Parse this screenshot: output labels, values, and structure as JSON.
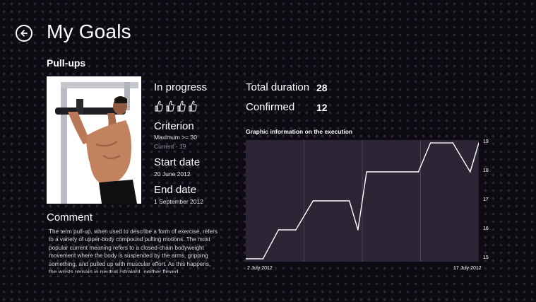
{
  "header": {
    "back_icon": "arrow-left-icon",
    "title": "My Goals"
  },
  "goal": {
    "name": "Pull-ups",
    "status": "In progress",
    "rating_icon": "thumbs-up-icon",
    "rating_count": 4,
    "criterion": {
      "label": "Criterion",
      "condition": "Maximum >= 30",
      "current_label": "Current",
      "current_sep": "-",
      "current_value": "19"
    },
    "start": {
      "label": "Start date",
      "value": "20  June  2012"
    },
    "end": {
      "label": "End date",
      "value": "1  September  2012"
    },
    "comment": {
      "label": "Comment",
      "text": "The term pull-up, when used to describe a form of exercise, refers to a variety of upper-body compound pulling motions. The most popular current meaning refers to a closed-chain bodyweight movement where the body is suspended by the arms, gripping something, and pulled up with muscular effort. As this happens, the wrists remain in neutral (straight, neither flexed"
    }
  },
  "stats": {
    "total_duration": {
      "label": "Total duration",
      "value": "28"
    },
    "confirmed": {
      "label": "Confirmed",
      "value": "12"
    }
  },
  "chart_data": {
    "type": "line",
    "title": "Graphic information on the execution",
    "x_start_label": "2 July 2012",
    "x_end_label": "17 July 2012",
    "y_ticks": [
      15,
      16,
      17,
      18,
      19
    ],
    "ylim": [
      14.9,
      19.1
    ],
    "grid": true,
    "x": [
      0,
      1,
      1.9,
      2.9,
      3.9,
      6.0,
      6.5,
      7.0,
      10.0,
      10.7,
      12.0,
      13.0,
      13.5
    ],
    "values": [
      15,
      15,
      16,
      16,
      17,
      17,
      16,
      18,
      18,
      19,
      19,
      18,
      19
    ],
    "xlim": [
      0,
      13.5
    ],
    "colors": {
      "line": "#ffffff",
      "background": "#2c2536",
      "grid": "#4a4256"
    }
  }
}
